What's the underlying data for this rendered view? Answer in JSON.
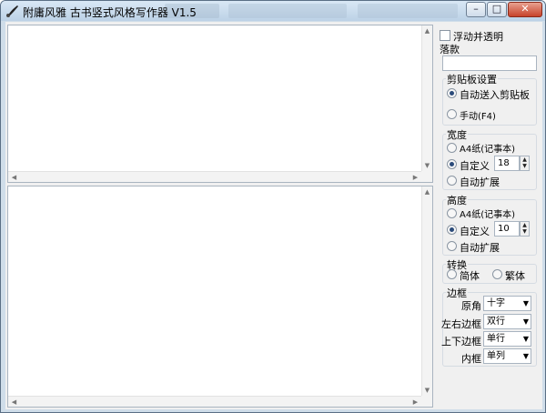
{
  "window": {
    "title": "附庸风雅 古书竖式风格写作器 V1.5",
    "minimize": "–",
    "maximize": "□",
    "close": "✕"
  },
  "panel": {
    "float_transparent": "浮动并透明",
    "signature_label": "落款",
    "signature_value": "",
    "clipboard": {
      "title": "剪贴板设置",
      "auto": "自动送入剪贴板",
      "manual": "手动(F4)"
    },
    "width": {
      "title": "宽度",
      "a4": "A4纸(记事本)",
      "custom": "自定义",
      "custom_value": "18",
      "auto": "自动扩展"
    },
    "height": {
      "title": "高度",
      "a4": "A4纸(记事本)",
      "custom": "自定义",
      "custom_value": "10",
      "auto": "自动扩展"
    },
    "convert": {
      "title": "转换",
      "simplified": "简体",
      "traditional": "繁体"
    },
    "border": {
      "title": "边框",
      "corner_label": "原角",
      "corner_value": "十字",
      "lr_label": "左右边框",
      "lr_value": "双行",
      "tb_label": "上下边框",
      "tb_value": "单行",
      "inner_label": "内框",
      "inner_value": "单列"
    }
  }
}
